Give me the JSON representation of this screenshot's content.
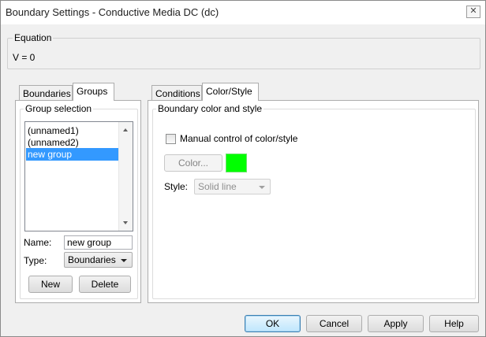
{
  "window": {
    "title": "Boundary Settings - Conductive Media DC (dc)",
    "close_glyph": "✕"
  },
  "equation": {
    "legend": "Equation",
    "text": "V = 0"
  },
  "left_tabs": [
    {
      "label": "Boundaries"
    },
    {
      "label": "Groups"
    }
  ],
  "groups": {
    "legend": "Group selection",
    "items": [
      {
        "label": "(unnamed1)"
      },
      {
        "label": "(unnamed2)"
      },
      {
        "label": "new group"
      }
    ],
    "selected": "new group",
    "name_label": "Name:",
    "name_value": "new group",
    "type_label": "Type:",
    "type_value": "Boundaries",
    "new_button": "New",
    "delete_button": "Delete"
  },
  "right_tabs": [
    {
      "label": "Conditions"
    },
    {
      "label": "Color/Style"
    }
  ],
  "color_style": {
    "legend": "Boundary color and style",
    "manual_label": "Manual control of color/style",
    "manual_checked": false,
    "color_button": "Color...",
    "swatch_color": "#00ff00",
    "style_label": "Style:",
    "style_value": "Solid line"
  },
  "buttons": {
    "ok": "OK",
    "cancel": "Cancel",
    "apply": "Apply",
    "help": "Help"
  }
}
